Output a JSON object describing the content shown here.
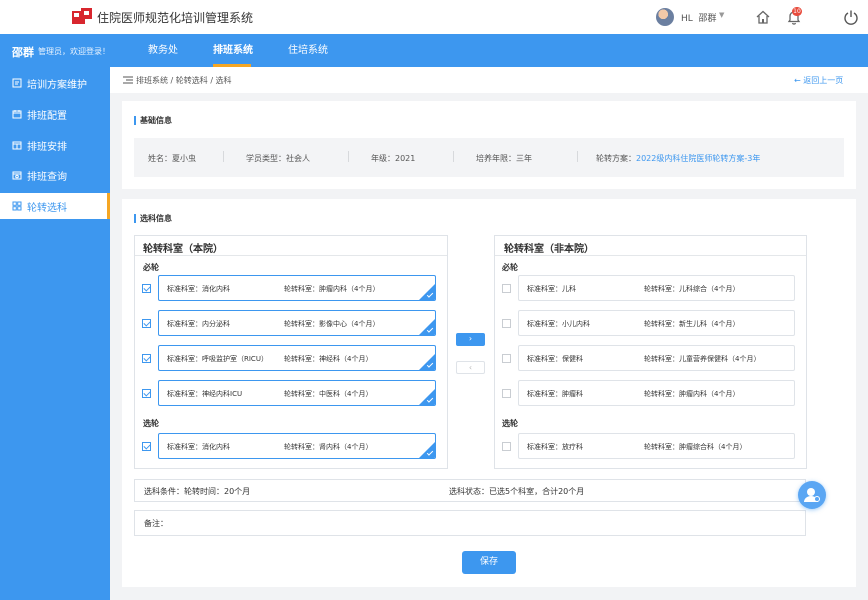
{
  "header": {
    "system_title": "住院医师规范化培训管理系统",
    "user_initials": "HL",
    "user_name": "邵群",
    "notification_count": "10"
  },
  "navbar": {
    "user": "邵群",
    "welcome": "管理员，欢迎登录！",
    "tabs": [
      {
        "label": "教务处",
        "active": false
      },
      {
        "label": "排班系统",
        "active": true
      },
      {
        "label": "住培系统",
        "active": false
      }
    ]
  },
  "sidebar": {
    "items": [
      {
        "label": "培训方案维护",
        "icon": "doc-edit-icon",
        "active": false
      },
      {
        "label": "排班配置",
        "icon": "config-icon",
        "active": false
      },
      {
        "label": "排班安排",
        "icon": "schedule-icon",
        "active": false
      },
      {
        "label": "排班查询",
        "icon": "query-icon",
        "active": false
      },
      {
        "label": "轮转选科",
        "icon": "grid-icon",
        "active": true
      }
    ]
  },
  "breadcrumb": {
    "path": "排班系统 / 轮转选科 / 选科",
    "back": "← 返回上一页"
  },
  "basic_info": {
    "title": "基础信息",
    "name": "姓名：夏小虫",
    "student_type": "学员类型：社会人",
    "grade": "年级：2021",
    "years": "培养年限：三年",
    "plan_label": "轮转方案：",
    "plan_value": "2022级内科住院医师轮转方案-3年"
  },
  "selection": {
    "title": "选科信息",
    "internal": {
      "title": "轮转科室（本院）",
      "required_label": "必轮",
      "required": [
        {
          "standard": "标准科室：消化内科",
          "rotation": "轮转科室：肿瘤内科（4个月）",
          "checked": true
        },
        {
          "standard": "标准科室：内分泌科",
          "rotation": "轮转科室：影像中心（4个月）",
          "checked": true
        },
        {
          "standard": "标准科室：呼吸监护室（RICU）",
          "rotation": "轮转科室：神经科（4个月）",
          "checked": true
        },
        {
          "standard": "标准科室：神经内科ICU",
          "rotation": "轮转科室：中医科（4个月）",
          "checked": true
        }
      ],
      "elective_label": "选轮",
      "elective": [
        {
          "standard": "标准科室：消化内科",
          "rotation": "轮转科室：肾内科（4个月）",
          "checked": true
        }
      ]
    },
    "external": {
      "title": "轮转科室（非本院）",
      "required_label": "必轮",
      "required": [
        {
          "standard": "标准科室：儿科",
          "rotation": "轮转科室：儿科综合（4个月）",
          "checked": false
        },
        {
          "standard": "标准科室：小儿内科",
          "rotation": "轮转科室：新生儿科（4个月）",
          "checked": false
        },
        {
          "standard": "标准科室：保健科",
          "rotation": "轮转科室：儿童营养保健科（4个月）",
          "checked": false
        },
        {
          "standard": "标准科室：肿瘤科",
          "rotation": "轮转科室：肿瘤内科（4个月）",
          "checked": false
        }
      ],
      "elective_label": "选轮",
      "elective": [
        {
          "standard": "标准科室：放疗科",
          "rotation": "轮转科室：肿瘤综合科（4个月）",
          "checked": false
        }
      ]
    },
    "move_right": "›",
    "move_left": "‹",
    "condition": "选科条件：轮转时间：20个月",
    "status": "选科状态：已选5个科室，合计20个月",
    "remark_label": "备注：",
    "save": "保存"
  },
  "colors": {
    "primary": "#3d97ef",
    "accent": "#f5a623",
    "badge": "#e84c3d"
  }
}
